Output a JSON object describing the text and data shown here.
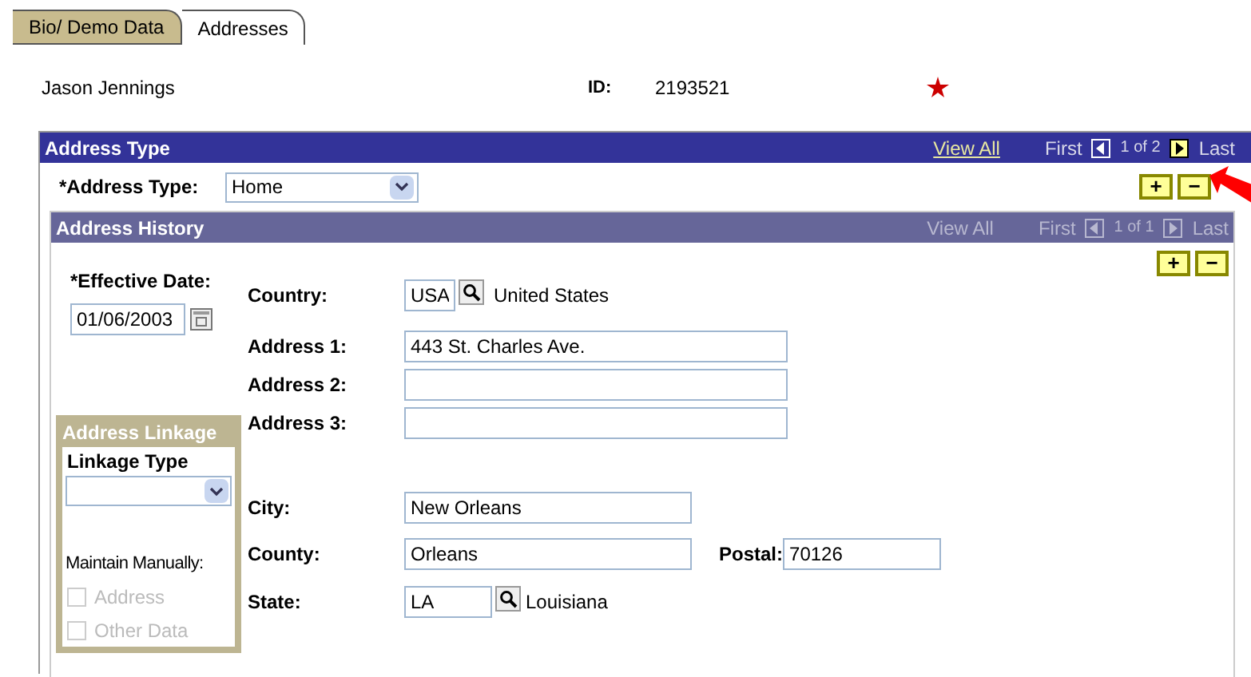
{
  "tabs": [
    {
      "label": "Bio/ Demo Data",
      "selected": false
    },
    {
      "label": "Addresses",
      "selected": true
    }
  ],
  "person": {
    "name": "Jason Jennings",
    "id_label": "ID:",
    "id": "2193521"
  },
  "address_type": {
    "title": "Address Type",
    "view_all": "View All",
    "first": "First",
    "count": "1 of 2",
    "last": "Last",
    "disabled": false,
    "label": "*Address Type:",
    "value": "Home",
    "add": "+",
    "remove": "−"
  },
  "address_history": {
    "title": "Address History",
    "view_all": "View All",
    "first": "First",
    "count": "1 of 1",
    "last": "Last",
    "disabled": true,
    "add": "+",
    "remove": "−"
  },
  "effective_date": {
    "label": "*Effective Date:",
    "value": "01/06/2003"
  },
  "country": {
    "label": "Country:",
    "code": "USA",
    "name": "United States"
  },
  "address_lines": [
    {
      "label": "Address 1:",
      "value": "443 St. Charles Ave."
    },
    {
      "label": "Address 2:"
    },
    {
      "label": "Address 3:"
    }
  ],
  "city": {
    "label": "City:",
    "value": "New Orleans"
  },
  "county": {
    "label": "County:",
    "value": "Orleans"
  },
  "postal": {
    "label": "Postal:",
    "value": "70126"
  },
  "state": {
    "label": "State:",
    "code": "LA",
    "name": "Louisiana"
  },
  "linkage": {
    "title": "Address Linkage",
    "type_label": "Linkage Type",
    "maintain_label": "Maintain Manually:",
    "options": [
      {
        "label": "Address",
        "checked": false,
        "disabled": true
      },
      {
        "label": "Other Data",
        "checked": false,
        "disabled": true
      }
    ]
  }
}
